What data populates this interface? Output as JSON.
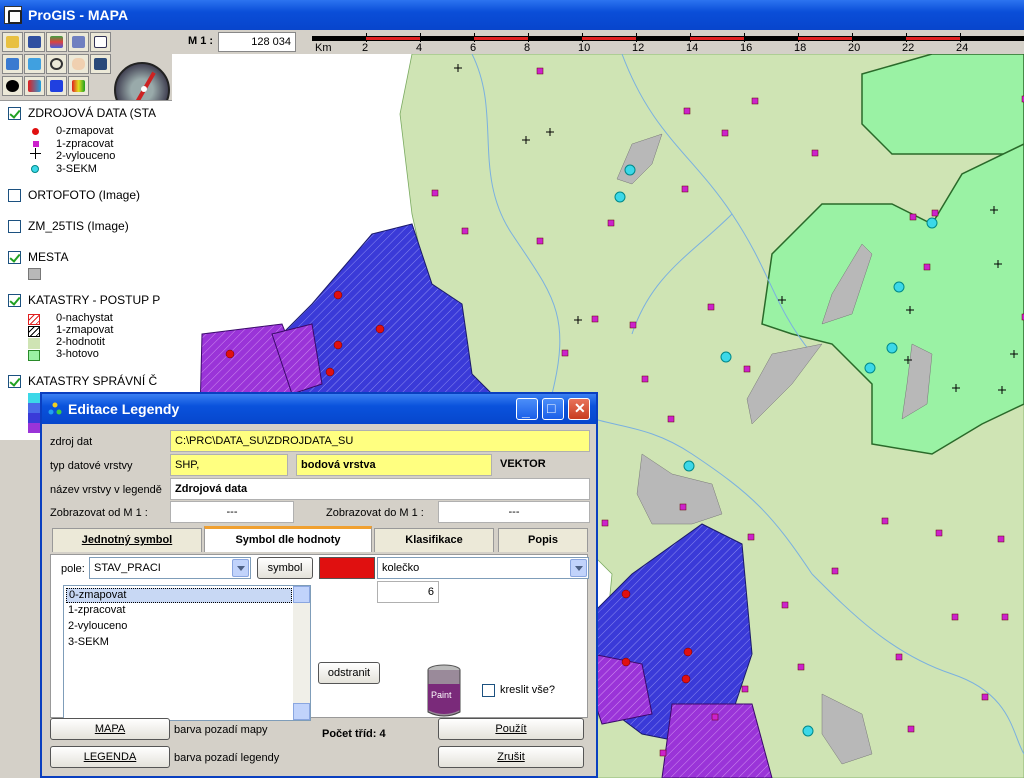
{
  "window": {
    "title": "ProGIS - MAPA"
  },
  "scale": {
    "label": "M 1 :",
    "value": "128 034",
    "unit": "Km",
    "ticks": [
      "2",
      "4",
      "6",
      "8",
      "10",
      "12",
      "14",
      "16",
      "18",
      "20",
      "22",
      "24"
    ]
  },
  "toolbar": {
    "icons": [
      "open-icon",
      "save-icon",
      "layers-icon",
      "table-icon",
      "edit-icon",
      "select-icon",
      "zoom-icon",
      "pan-icon",
      "pointer-icon",
      "info-icon",
      "add-layer-icon",
      "palette-icon"
    ]
  },
  "legend": {
    "layers": [
      {
        "name": "ZDROJOVÁ DATA (STA",
        "checked": true,
        "items": [
          "0-zmapovat",
          "1-zpracovat",
          "2-vylouceno",
          "3-SEKM"
        ]
      },
      {
        "name": "ORTOFOTO (Image)",
        "checked": false
      },
      {
        "name": "ZM_25TIS (Image)",
        "checked": false
      },
      {
        "name": "MESTA",
        "checked": true
      },
      {
        "name": "KATASTRY - POSTUP P",
        "checked": true,
        "items": [
          "0-nachystat",
          "1-zmapovat",
          "2-hodnotit",
          "3-hotovo"
        ]
      },
      {
        "name": "KATASTRY SPRÁVNÍ Č",
        "checked": true
      }
    ]
  },
  "dialog": {
    "title": "Editace Legendy",
    "source_label": "zdroj dat",
    "source_value": "C:\\PRC\\DATA_SU\\ZDROJDATA_SU",
    "type_label": "typ datové vrstvy",
    "type_value": "SHP,",
    "geom_value": "bodová vrstva",
    "vector_value": "VEKTOR",
    "name_label": "název vrstvy v legendě",
    "name_value": "Zdrojová data",
    "show_from_label": "Zobrazovat od  M  1 :",
    "show_from_value": "---",
    "show_to_label": "Zobrazovat do  M  1 :",
    "show_to_value": "---",
    "tabs": [
      "Jednotný symbol",
      "Symbol dle hodnoty",
      "Klasifikace",
      "Popis"
    ],
    "field_label": "pole:",
    "field_value": "STAV_PRACI",
    "symbol_button": "symbol",
    "shape_value": "kolečko",
    "size_value": "6",
    "values": [
      "0-zmapovat",
      "1-zpracovat",
      "2-vylouceno",
      "3-SEKM"
    ],
    "remove_button": "odstranit",
    "draw_all_label": "kreslit vše?",
    "class_count": "Počet tříd: 4",
    "map_button": "MAPA",
    "map_bg_label": "barva pozadí mapy",
    "legend_button": "LEGENDA",
    "legend_bg_label": "barva pozadí legendy",
    "apply_button": "Použít",
    "cancel_button": "Zrušit",
    "paint_text": "Paint",
    "symbol_color": "#e01010"
  },
  "colors": {
    "polygon_light": "#cfe4b4",
    "polygon_done": "#9af2a4",
    "polygon_blue": "#3a3ad8",
    "polygon_purple": "#9a34d8",
    "town_gray": "#b8b8b8",
    "point_magenta": "#cc22cc",
    "point_cyan": "#3cd8e8",
    "river": "#7ab0e0"
  }
}
